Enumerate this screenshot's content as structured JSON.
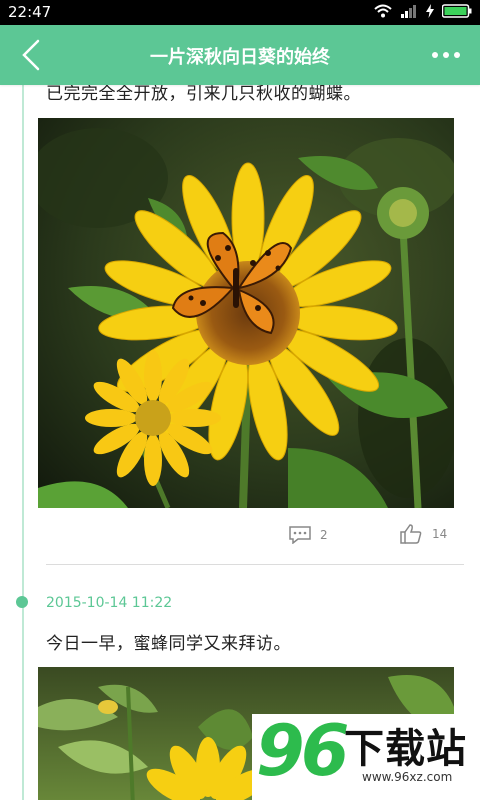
{
  "status_bar": {
    "time": "22:47"
  },
  "header": {
    "title": "一片深秋向日葵的始终"
  },
  "entries": [
    {
      "text": "已完完全全开放，引来几只秋收的蝴蝶。",
      "comment_count": "2",
      "like_count": "14"
    },
    {
      "date": "2015-10-14 11:22",
      "text": "今日一早，蜜蜂同学又来拜访。"
    }
  ],
  "watermark": {
    "logo_number": "96",
    "logo_text": "下载站",
    "url": "www.96xz.com"
  },
  "colors": {
    "accent": "#5cc795",
    "timeline": "#bfe9d5",
    "watermark_green": "#2dbb4d"
  }
}
